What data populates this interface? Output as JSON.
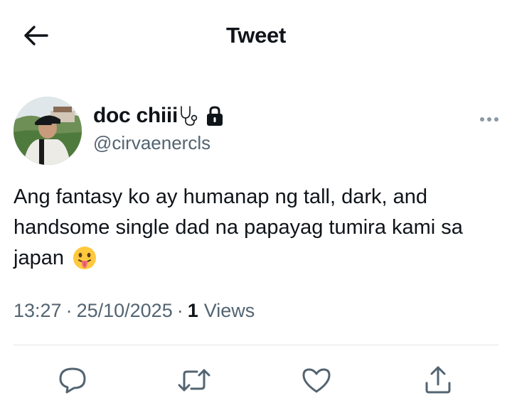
{
  "header": {
    "title": "Tweet"
  },
  "tweet": {
    "display_name": "doc chiii",
    "handle": "@cirvaenercls",
    "text": "Ang fantasy ko ay humanap ng tall, dark, and handsome single dad na papayag tumira kami sa japan",
    "time": "13:27",
    "separator": "·",
    "date": "25/10/2025",
    "views_count": "1",
    "views_label": "Views"
  },
  "icons": {
    "back": "arrow-left-icon",
    "badge": "stethoscope-icon",
    "lock": "lock-icon",
    "more": "more-horizontal-icon",
    "emoji": "face-with-tongue-emoji",
    "reply": "reply-bubble-icon",
    "retweet": "retweet-icon",
    "like": "heart-icon",
    "share": "share-upload-icon"
  },
  "colors": {
    "text": "#0f1419",
    "secondary": "#536471",
    "divider": "#e1e4e8"
  }
}
